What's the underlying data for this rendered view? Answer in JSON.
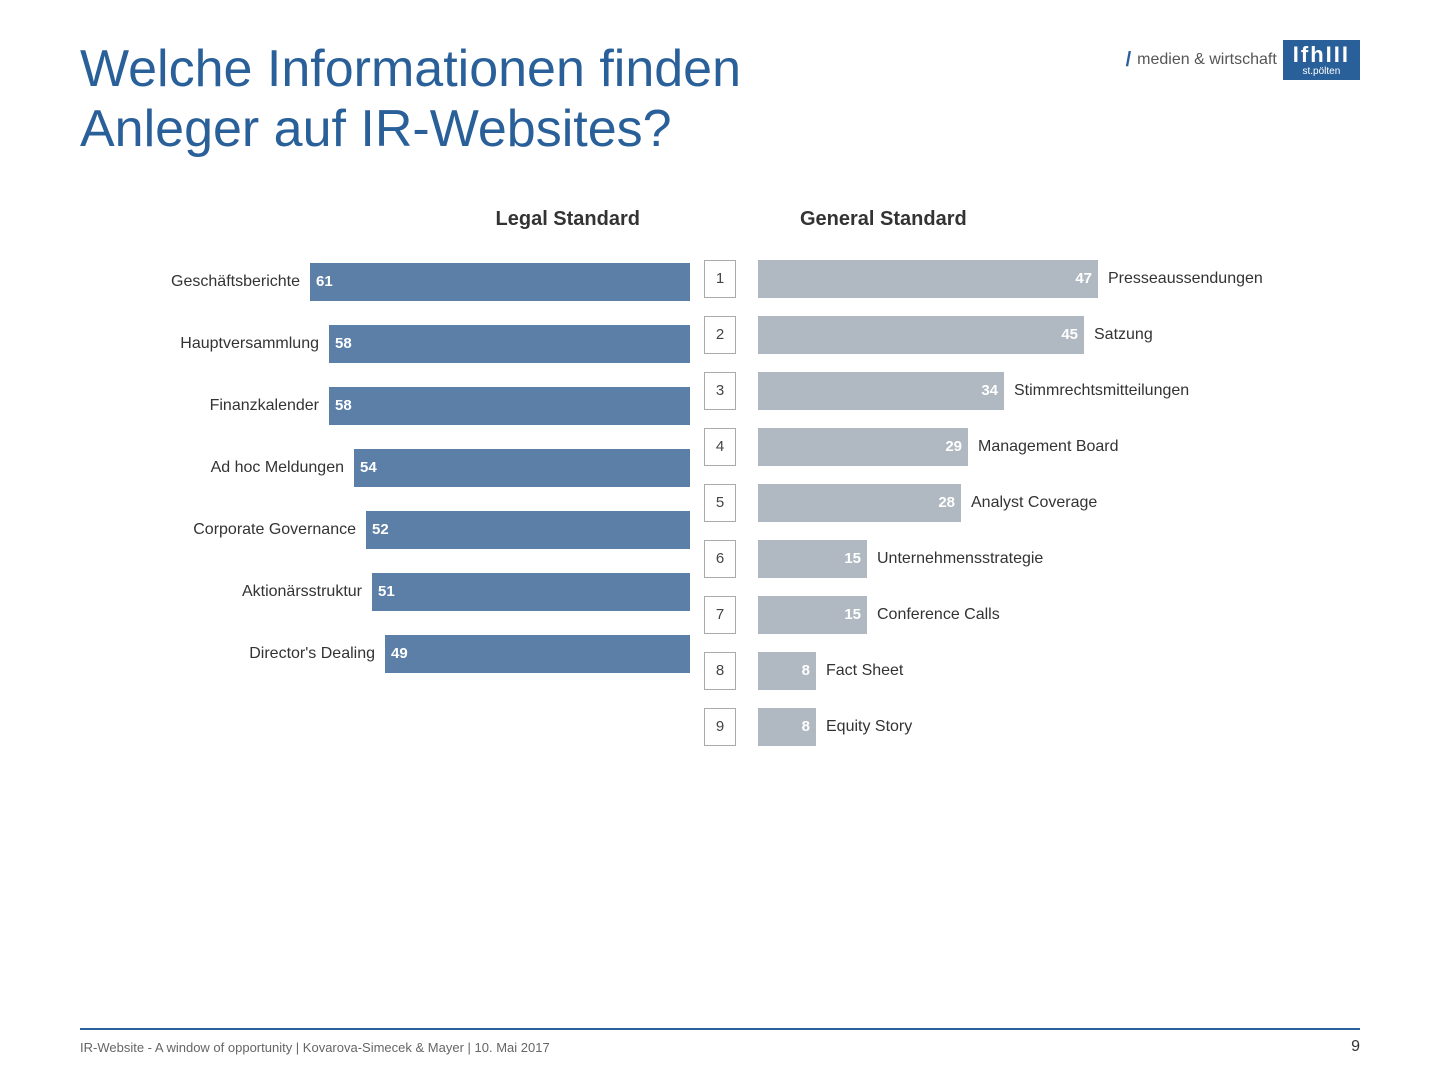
{
  "header": {
    "title_line1": "Welche Informationen finden",
    "title_line2": "Anleger auf IR-Websites?",
    "logo_slash": "/",
    "logo_medien": "medien & wirtschaft",
    "logo_fh_top": "IfhIII",
    "logo_fh_bottom": "st.pölten"
  },
  "chart": {
    "left_column_title": "Legal Standard",
    "right_column_title": "General Standard",
    "left_items": [
      {
        "label": "Geschäftsberichte",
        "value": 61,
        "max": 61
      },
      {
        "label": "Hauptversammlung",
        "value": 58,
        "max": 61
      },
      {
        "label": "Finanzkalender",
        "value": 58,
        "max": 61
      },
      {
        "label": "Ad hoc Meldungen",
        "value": 54,
        "max": 61
      },
      {
        "label": "Corporate Governance",
        "value": 52,
        "max": 61
      },
      {
        "label": "Aktionärsstruktur",
        "value": 51,
        "max": 61
      },
      {
        "label": "Director's Dealing",
        "value": 49,
        "max": 61
      }
    ],
    "right_items": [
      {
        "label": "Presseaussendungen",
        "value": 47,
        "max": 47
      },
      {
        "label": "Satzung",
        "value": 45,
        "max": 47
      },
      {
        "label": "Stimmrechtsmitteilungen",
        "value": 34,
        "max": 47
      },
      {
        "label": "Management Board",
        "value": 29,
        "max": 47
      },
      {
        "label": "Analyst Coverage",
        "value": 28,
        "max": 47
      },
      {
        "label": "Unternehmensstrategie",
        "value": 15,
        "max": 47
      },
      {
        "label": "Conference Calls",
        "value": 15,
        "max": 47
      },
      {
        "label": "Fact Sheet",
        "value": 8,
        "max": 47
      },
      {
        "label": "Equity Story",
        "value": 8,
        "max": 47
      }
    ],
    "ranks": [
      1,
      2,
      3,
      4,
      5,
      6,
      7,
      8,
      9
    ]
  },
  "footer": {
    "citation": "IR-Website - A window of opportunity | Kovarova-Simecek & Mayer | 10. Mai 2017",
    "page_number": "9"
  }
}
